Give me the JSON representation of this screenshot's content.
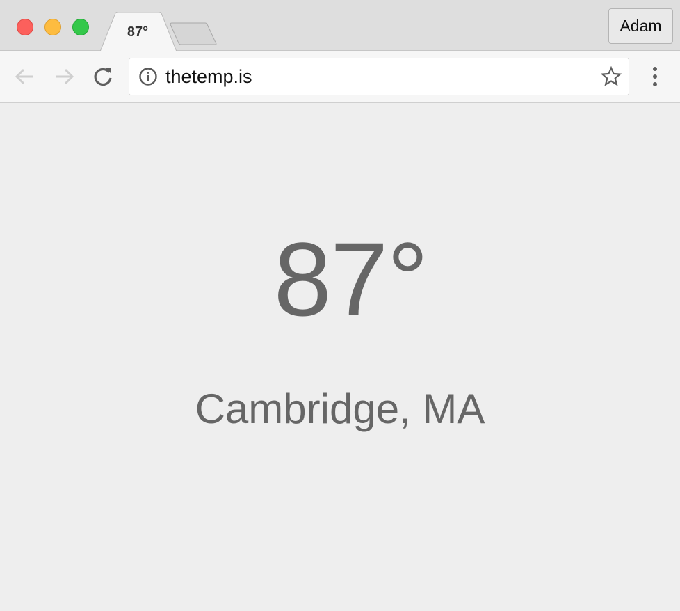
{
  "browser": {
    "tab": {
      "title": "87°"
    },
    "profile": {
      "name": "Adam"
    },
    "address_bar": {
      "url": "thetemp.is"
    },
    "icons": {
      "back": "arrow-left-icon",
      "forward": "arrow-right-icon",
      "reload": "reload-icon",
      "site_info": "info-icon",
      "bookmark": "star-icon",
      "menu": "vertical-dots-icon"
    },
    "colors": {
      "close": "#fc605c",
      "minimize": "#fdbc40",
      "maximize": "#34c84a"
    }
  },
  "page": {
    "temperature": "87°",
    "location": "Cambridge, MA",
    "text_color": "#666666",
    "background": "#eeeeee"
  }
}
